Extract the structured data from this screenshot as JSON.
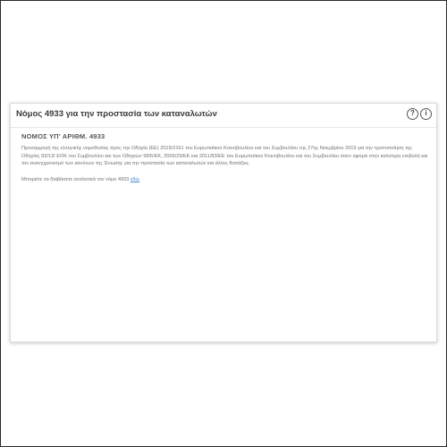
{
  "panel": {
    "title": "Νόμος 4933 για την προστασία των καταναλωτών",
    "icons": {
      "help": "?",
      "info": "i",
      "help_icon": "question-circle-icon",
      "info_icon": "info-circle-icon"
    },
    "law_heading": "ΝΟΜΟΣ ΥΠ' ΑΡΙΘΜ. 4933",
    "description": "Προσαρμογή της ελληνικής νομοθεσίας προς την Οδηγία (ΕΕ) 2019/2161 του Ευρωπαϊκού Κοινοβουλίου και του Συμβουλίου της 27ης Νοεμβρίου 2019 για την τροποποίηση της Οδηγίας 93/13/ ΕΟΚ του Συμβουλίου και των Οδηγιών 98/6/ΕΚ, 2005/29/ΕΚ και 2011/83/ΕΕ του Ευρωπαϊκού Κοινοβουλίου και του Συμβουλίου όσον αφορά στην καλύτερη επιβολή και τον εκσυγχρονισμό των κανόνων της Ένωσης για την προστασία των καταναλωτών και άλλες διατάξεις.",
    "read_more_text": "Μπορείτε να διαβάσετε αναλυτικά τον νόμο 4933",
    "read_more_link": "εδώ"
  }
}
